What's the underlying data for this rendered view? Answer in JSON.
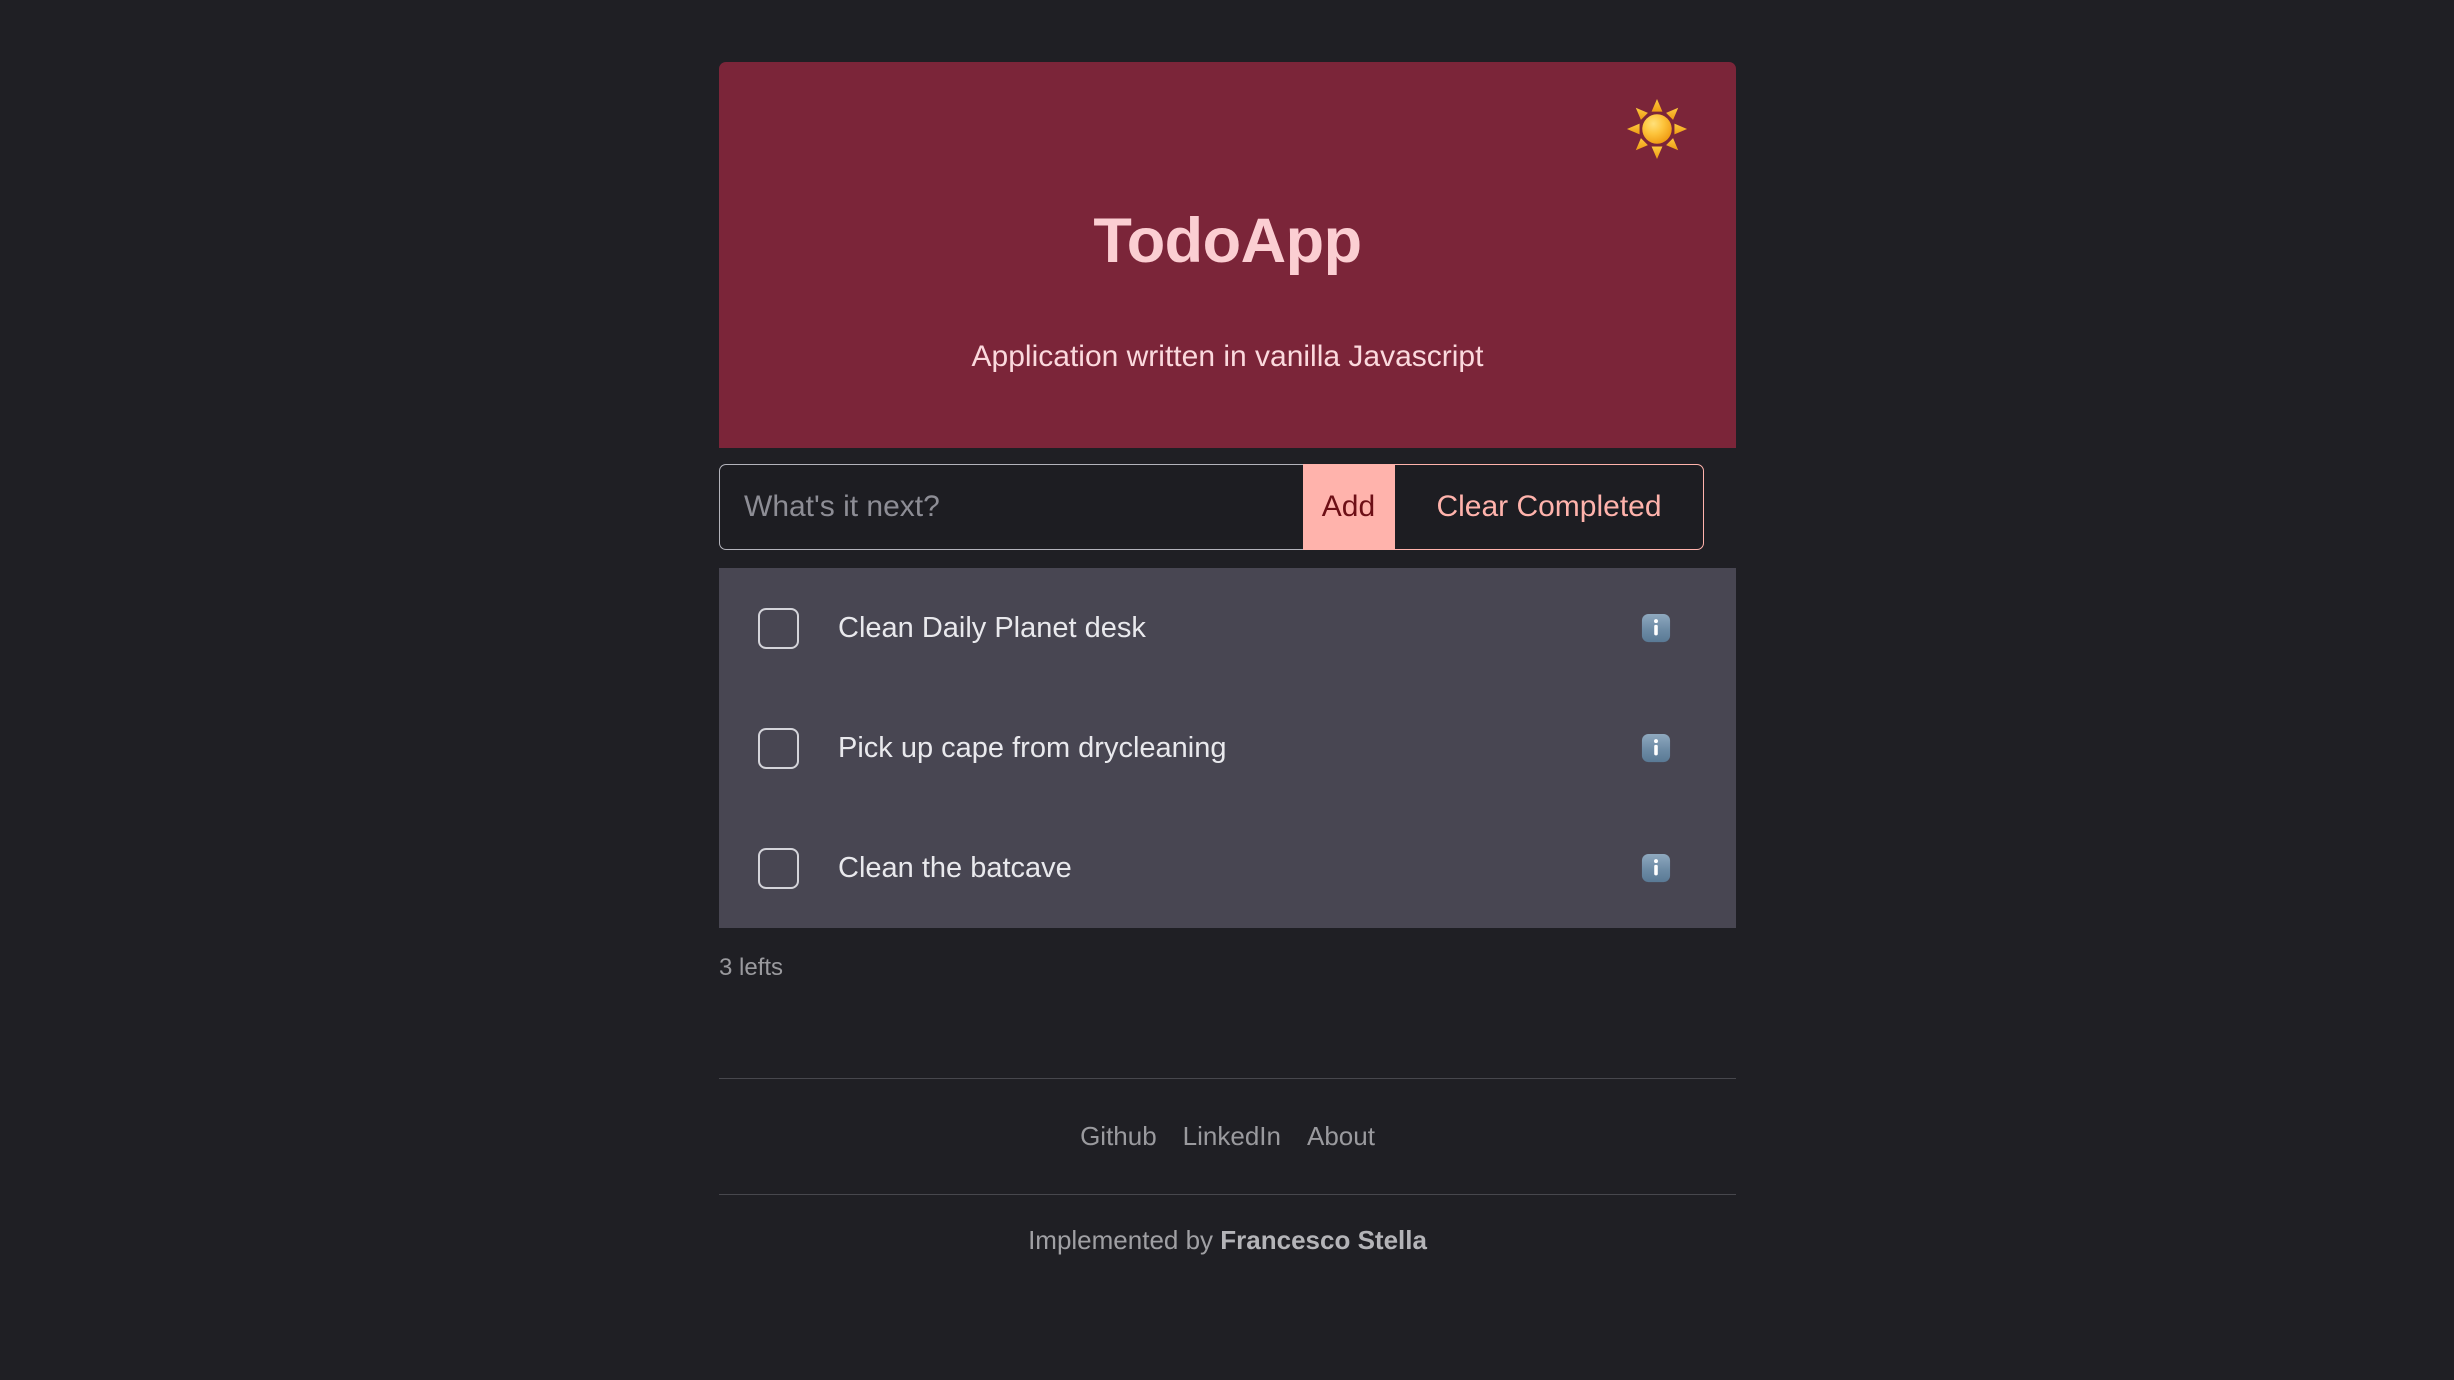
{
  "theme": {
    "page_background": "#1f1f24",
    "header_background": "#7b2539",
    "list_background": "#484652",
    "accent_pink": "#ffb3ac",
    "accent_dark_red": "#6d0f16",
    "title_pink": "#fbced2"
  },
  "header": {
    "title": "TodoApp",
    "subtitle": "Application written in vanilla Javascript",
    "theme_toggle_icon": "sun-icon"
  },
  "entry": {
    "input_value": "",
    "input_placeholder": "What's it next?",
    "add_label": "Add",
    "clear_label": "Clear Completed"
  },
  "todos": [
    {
      "label": "Clean Daily Planet desk",
      "checked": false,
      "info_icon": "information-icon"
    },
    {
      "label": "Pick up cape from drycleaning",
      "checked": false,
      "info_icon": "information-icon"
    },
    {
      "label": "Clean the batcave",
      "checked": false,
      "info_icon": "information-icon"
    }
  ],
  "status": {
    "items_left": "3 lefts"
  },
  "footer": {
    "links": [
      {
        "label": "Github"
      },
      {
        "label": "LinkedIn"
      },
      {
        "label": "About"
      }
    ],
    "credit_prefix": "Implemented by ",
    "credit_author": "Francesco Stella"
  }
}
